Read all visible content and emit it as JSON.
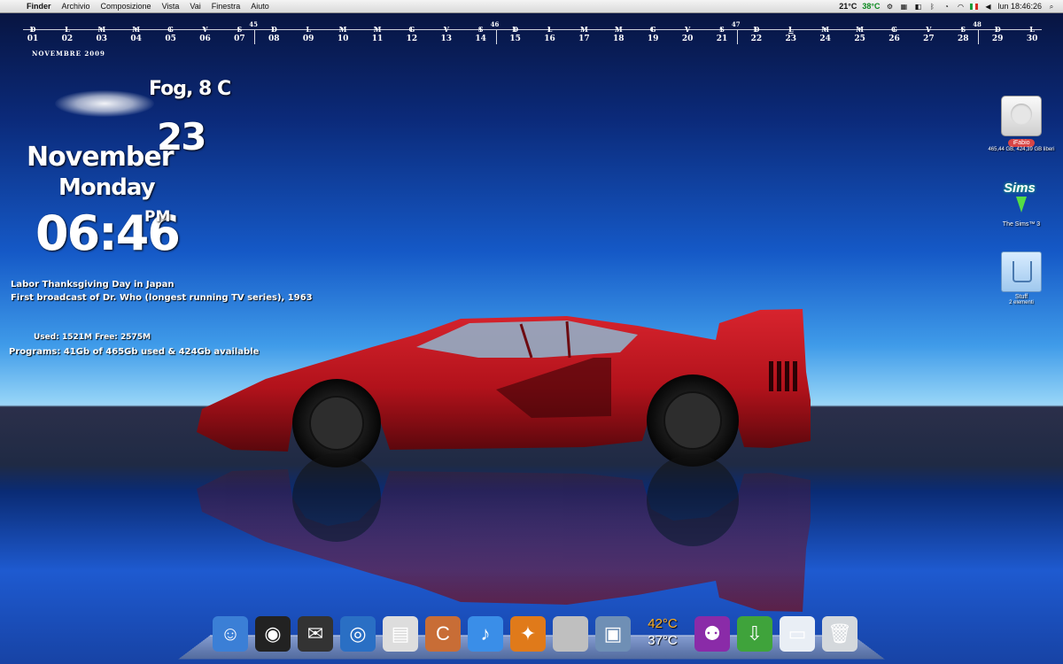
{
  "menubar": {
    "apple": "",
    "items": [
      "Finder",
      "Archivio",
      "Composizione",
      "Vista",
      "Vai",
      "Finestra",
      "Aiuto"
    ],
    "temp_cpu": "21°C",
    "temp_gpu": "38°C",
    "datetime": "lun 18:46:26"
  },
  "calendar": {
    "month_label": "NOVEMBRE 2009",
    "days": [
      {
        "l": "D",
        "n": "01"
      },
      {
        "l": "L",
        "n": "02"
      },
      {
        "l": "M",
        "n": "03"
      },
      {
        "l": "M",
        "n": "04"
      },
      {
        "l": "G",
        "n": "05"
      },
      {
        "l": "V",
        "n": "06"
      },
      {
        "l": "S",
        "n": "07"
      },
      {
        "l": "D",
        "n": "08"
      },
      {
        "l": "L",
        "n": "09"
      },
      {
        "l": "M",
        "n": "10"
      },
      {
        "l": "M",
        "n": "11"
      },
      {
        "l": "G",
        "n": "12"
      },
      {
        "l": "V",
        "n": "13"
      },
      {
        "l": "S",
        "n": "14"
      },
      {
        "l": "D",
        "n": "15"
      },
      {
        "l": "L",
        "n": "16"
      },
      {
        "l": "M",
        "n": "17"
      },
      {
        "l": "M",
        "n": "18"
      },
      {
        "l": "G",
        "n": "19"
      },
      {
        "l": "V",
        "n": "20"
      },
      {
        "l": "S",
        "n": "21"
      },
      {
        "l": "D",
        "n": "22"
      },
      {
        "l": "L",
        "n": "23"
      },
      {
        "l": "M",
        "n": "24"
      },
      {
        "l": "M",
        "n": "25"
      },
      {
        "l": "G",
        "n": "26"
      },
      {
        "l": "V",
        "n": "27"
      },
      {
        "l": "S",
        "n": "28"
      },
      {
        "l": "D",
        "n": "29"
      },
      {
        "l": "L",
        "n": "30"
      }
    ],
    "weeks": [
      "45",
      "46",
      "47",
      "48"
    ],
    "today": "23"
  },
  "weather": {
    "text": "Fog, 8 C"
  },
  "clock": {
    "day": "23",
    "month": "November",
    "weekday": "Monday",
    "time": "06:46",
    "ampm": "PM"
  },
  "events": [
    "Labor Thanksgiving Day in Japan",
    "First broadcast of Dr. Who (longest running TV series), 1963"
  ],
  "system": {
    "memory": "Used: 1521M Free: 2575M",
    "programs": "Programs: 41Gb of 465Gb used & 424Gb available"
  },
  "desktop_icons": [
    {
      "name": "iFabio",
      "sub": "465,44 GB, 424,39 GB liberi",
      "icon": "hard-drive-icon"
    },
    {
      "name": "The Sims™ 3",
      "sub": "",
      "icon": "sims-icon"
    },
    {
      "name": "Stuff",
      "sub": "2 elementi",
      "icon": "folder-icon"
    }
  ],
  "dock": {
    "items": [
      {
        "name": "finder",
        "color": "#3b7fd6",
        "glyph": "☺"
      },
      {
        "name": "ichat",
        "color": "#222222",
        "glyph": "◉"
      },
      {
        "name": "stamps",
        "color": "#333333",
        "glyph": "✉"
      },
      {
        "name": "safari",
        "color": "#2a6fc4",
        "glyph": "◎"
      },
      {
        "name": "newspaper",
        "color": "#dddddd",
        "glyph": "▤"
      },
      {
        "name": "camino",
        "color": "#c86d36",
        "glyph": "C"
      },
      {
        "name": "itunes",
        "color": "#3a8ee8",
        "glyph": "♪"
      },
      {
        "name": "blaster",
        "color": "#e07a1a",
        "glyph": "✦"
      },
      {
        "name": "boot-camp",
        "color": "#bfbfbf",
        "glyph": ""
      },
      {
        "name": "iphoto",
        "color": "#6f8fb5",
        "glyph": "▣"
      }
    ],
    "temp_high": "42°C",
    "temp_low": "37°C",
    "items_right": [
      {
        "name": "contacts",
        "color": "#8a2ba8",
        "glyph": "⚉"
      },
      {
        "name": "downloads",
        "color": "#3fa33b",
        "glyph": "⇩"
      },
      {
        "name": "mail-window",
        "color": "#e9eef5",
        "glyph": "▭"
      },
      {
        "name": "trash",
        "color": "#d4d8dc",
        "glyph": "🗑"
      }
    ]
  },
  "colors": {
    "car": "#b2121b",
    "sky_top": "#07123a",
    "sky_horizon": "#9ed6f7",
    "hdd_badge": "#d84545"
  }
}
